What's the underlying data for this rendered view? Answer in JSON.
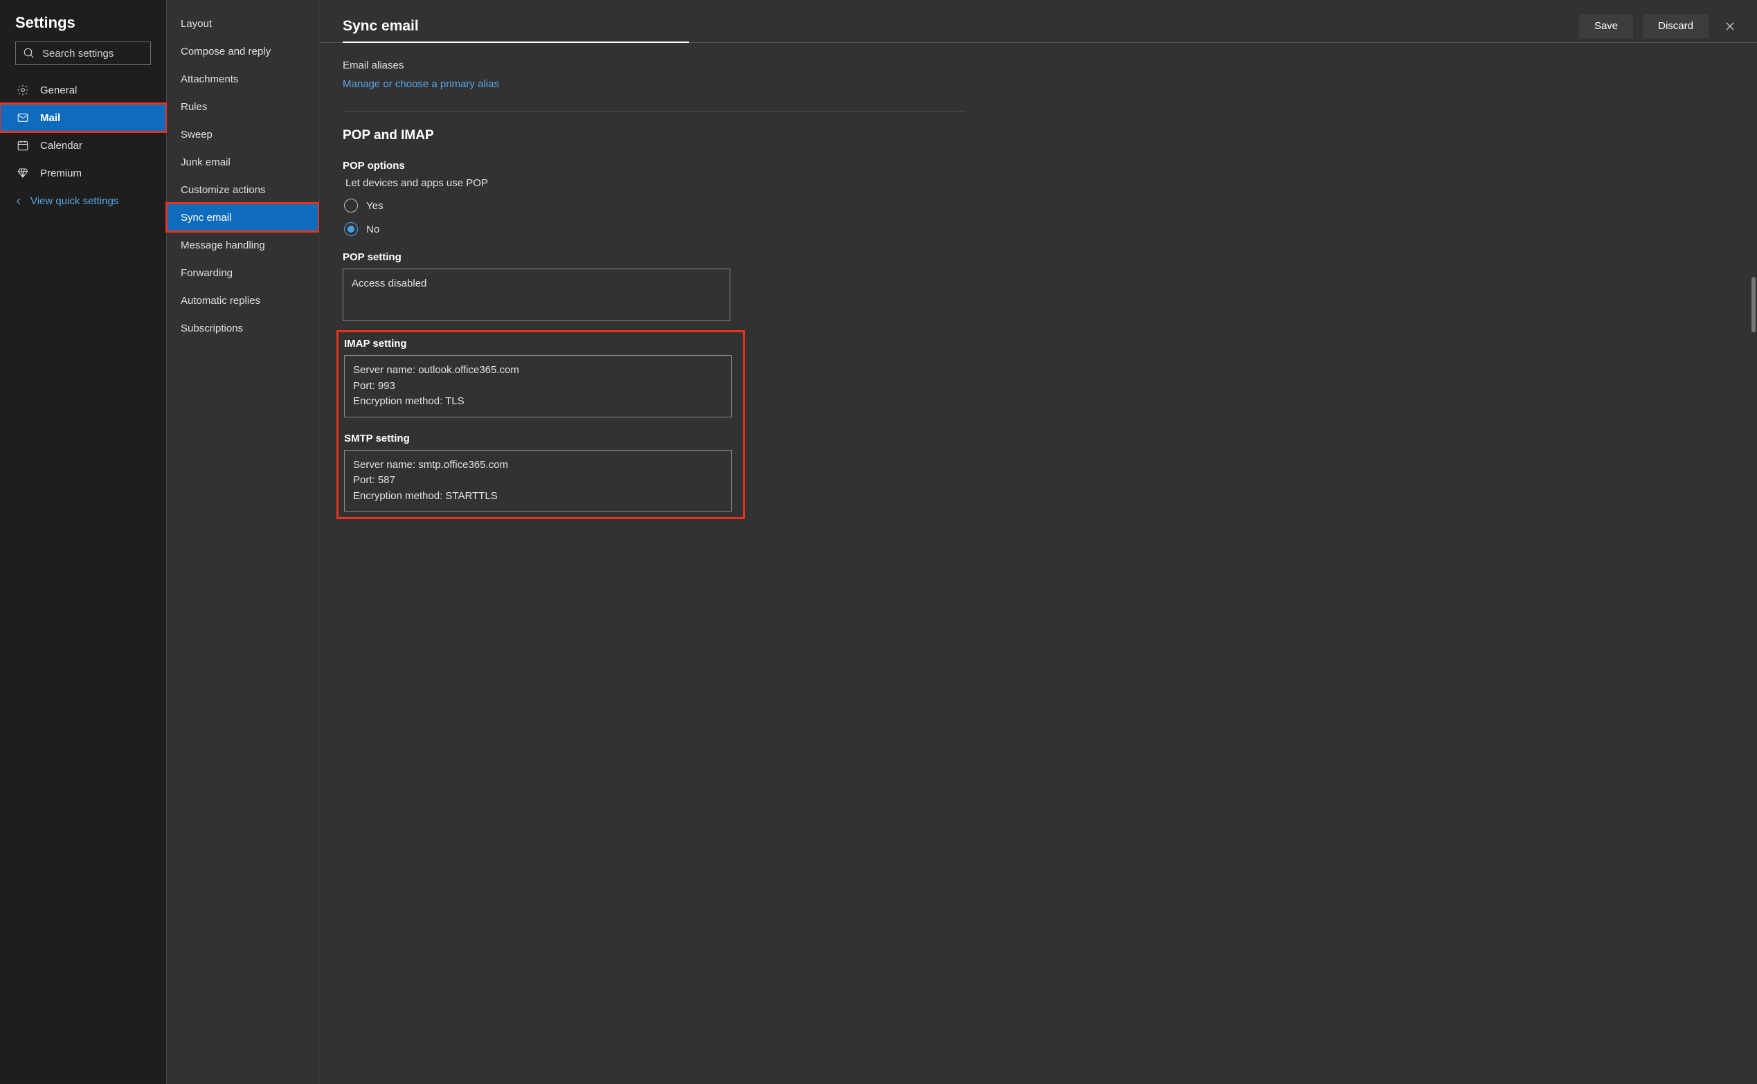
{
  "sidebar": {
    "title": "Settings",
    "search_placeholder": "Search settings",
    "items": [
      {
        "label": "General"
      },
      {
        "label": "Mail"
      },
      {
        "label": "Calendar"
      },
      {
        "label": "Premium"
      }
    ],
    "quick_link": "View quick settings"
  },
  "submenu": {
    "items": [
      {
        "label": "Layout"
      },
      {
        "label": "Compose and reply"
      },
      {
        "label": "Attachments"
      },
      {
        "label": "Rules"
      },
      {
        "label": "Sweep"
      },
      {
        "label": "Junk email"
      },
      {
        "label": "Customize actions"
      },
      {
        "label": "Sync email"
      },
      {
        "label": "Message handling"
      },
      {
        "label": "Forwarding"
      },
      {
        "label": "Automatic replies"
      },
      {
        "label": "Subscriptions"
      }
    ]
  },
  "header": {
    "title": "Sync email",
    "save": "Save",
    "discard": "Discard"
  },
  "aliases": {
    "label": "Email aliases",
    "link": "Manage or choose a primary alias"
  },
  "pop_imap": {
    "heading": "POP and IMAP",
    "pop_options_label": "POP options",
    "pop_question": "Let devices and apps use POP",
    "yes": "Yes",
    "no": "No",
    "pop_setting_label": "POP setting",
    "pop_setting_value": "Access disabled",
    "imap_setting_label": "IMAP setting",
    "imap_server": "Server name: outlook.office365.com",
    "imap_port": "Port: 993",
    "imap_enc": "Encryption method: TLS",
    "smtp_setting_label": "SMTP setting",
    "smtp_server": "Server name: smtp.office365.com",
    "smtp_port": "Port: 587",
    "smtp_enc": "Encryption method: STARTTLS"
  }
}
